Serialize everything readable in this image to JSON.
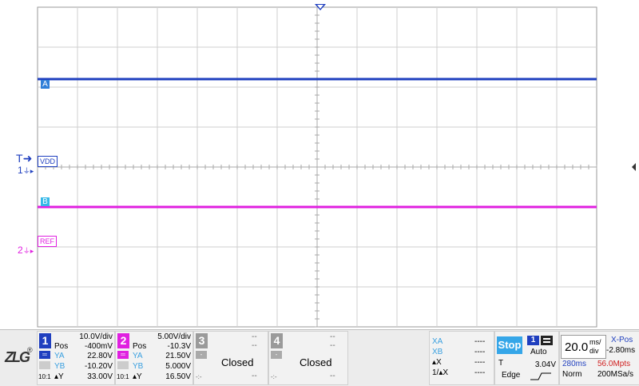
{
  "screen": {
    "trigger_marker": "T",
    "ch1_marker": "1",
    "ch2_marker": "2",
    "cursor_a": "A",
    "cursor_b": "B",
    "label_vdd": "VDD",
    "label_ref": "REF",
    "ch1_color": "#1f3fbf",
    "ch2_color": "#e020e0",
    "trace_ch1_level_div": 2.2,
    "trace_ch2_level_div": -1.0,
    "h_divisions": 14,
    "v_divisions": 8
  },
  "logo": {
    "text": "ZLG",
    "registered": "®"
  },
  "ch1": {
    "num": "1",
    "scale": "10.0V/div",
    "pos_label": "Pos",
    "pos": "-400mV",
    "ya_label": "YA",
    "ya": "22.80V",
    "yb_label": "YB",
    "yb": "-10.20V",
    "dy_label": "▴Y",
    "dy": "33.00V",
    "coupling": "10:1"
  },
  "ch2": {
    "num": "2",
    "scale": "5.00V/div",
    "pos_label": "Pos",
    "pos": "-10.3V",
    "ya_label": "YA",
    "ya": "21.50V",
    "yb_label": "YB",
    "yb": "5.000V",
    "dy_label": "▴Y",
    "dy": "16.50V",
    "coupling": "10:1"
  },
  "ch3": {
    "num": "3",
    "state": "Closed",
    "dash": "--",
    "minus": "-"
  },
  "ch4": {
    "num": "4",
    "state": "Closed",
    "dash": "--",
    "minus": "-"
  },
  "cursors": {
    "xa_label": "XA",
    "xa": "----",
    "xb_label": "XB",
    "xb": "----",
    "dx_label": "▴X",
    "dx": "----",
    "inv_dx_label": "1/▴X",
    "inv_dx": "----"
  },
  "trigger": {
    "status": "Stop",
    "source": "1",
    "mode": "Auto",
    "t_label": "T",
    "level": "3.04V",
    "type": "Edge"
  },
  "timebase": {
    "value": "20.0",
    "unit_top": "ms/",
    "unit_bottom": "div",
    "xpos_label": "X-Pos",
    "xpos": "-2.80ms",
    "window": "280ms",
    "points": "56.0Mpts",
    "acq_mode": "Norm",
    "sample_rate": "200MSa/s"
  }
}
